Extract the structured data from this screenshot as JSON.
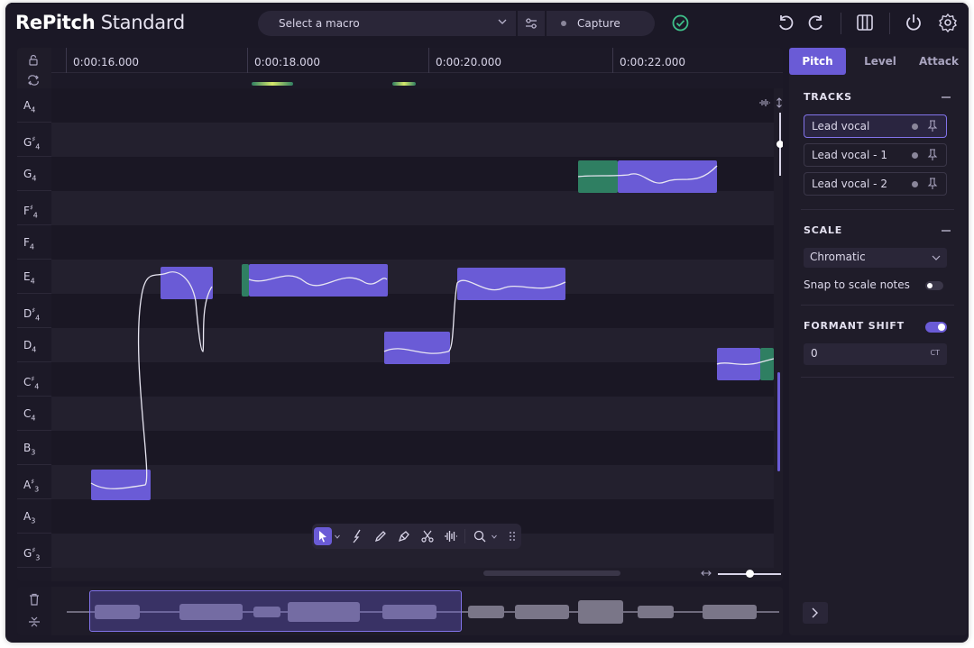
{
  "app": {
    "name_bold": "RePitch",
    "name_light": " Standard"
  },
  "topbar": {
    "macro_placeholder": "Select a macro",
    "capture_label": "Capture",
    "icons": [
      "chevron-down-icon",
      "sliders-icon",
      "check-circle-icon",
      "undo-icon",
      "redo-icon",
      "columns-icon",
      "power-icon",
      "gear-icon"
    ]
  },
  "ruler": {
    "times": [
      "0:00:16.000",
      "0:00:18.000",
      "0:00:20.000",
      "0:00:22.000"
    ]
  },
  "piano": {
    "keys": [
      {
        "n": "A",
        "acc": "",
        "o": "4"
      },
      {
        "n": "G",
        "acc": "♯",
        "o": "4"
      },
      {
        "n": "G",
        "acc": "",
        "o": "4"
      },
      {
        "n": "F",
        "acc": "♯",
        "o": "4"
      },
      {
        "n": "F",
        "acc": "",
        "o": "4"
      },
      {
        "n": "E",
        "acc": "",
        "o": "4"
      },
      {
        "n": "D",
        "acc": "♯",
        "o": "4"
      },
      {
        "n": "D",
        "acc": "",
        "o": "4"
      },
      {
        "n": "C",
        "acc": "♯",
        "o": "4"
      },
      {
        "n": "C",
        "acc": "",
        "o": "4"
      },
      {
        "n": "B",
        "acc": "",
        "o": "3"
      },
      {
        "n": "A",
        "acc": "♯",
        "o": "3"
      },
      {
        "n": "A",
        "acc": "",
        "o": "3"
      },
      {
        "n": "G",
        "acc": "♯",
        "o": "3"
      }
    ]
  },
  "tools": [
    "select-tool-icon",
    "pitch-tool-icon",
    "pencil-tool-icon",
    "draw-tool-icon",
    "scissors-icon",
    "waveform-icon",
    "zoom-icon",
    "drag-handle-icon"
  ],
  "panel": {
    "tabs": [
      "Pitch",
      "Level",
      "Attack"
    ],
    "active_tab": "Pitch",
    "tracks_title": "TRACKS",
    "tracks": [
      "Lead vocal",
      "Lead vocal - 1",
      "Lead vocal - 2"
    ],
    "selected_track": "Lead vocal",
    "scale_title": "SCALE",
    "scale_value": "Chromatic",
    "snap_label": "Snap to scale notes",
    "snap_enabled": false,
    "formant_title": "FORMANT SHIFT",
    "formant_enabled": true,
    "formant_value": "0",
    "formant_unit": "CT"
  },
  "colors": {
    "accent": "#6a5bd6",
    "note_green": "#2f7f62",
    "background": "#1b1826",
    "success": "#3ec08a"
  }
}
